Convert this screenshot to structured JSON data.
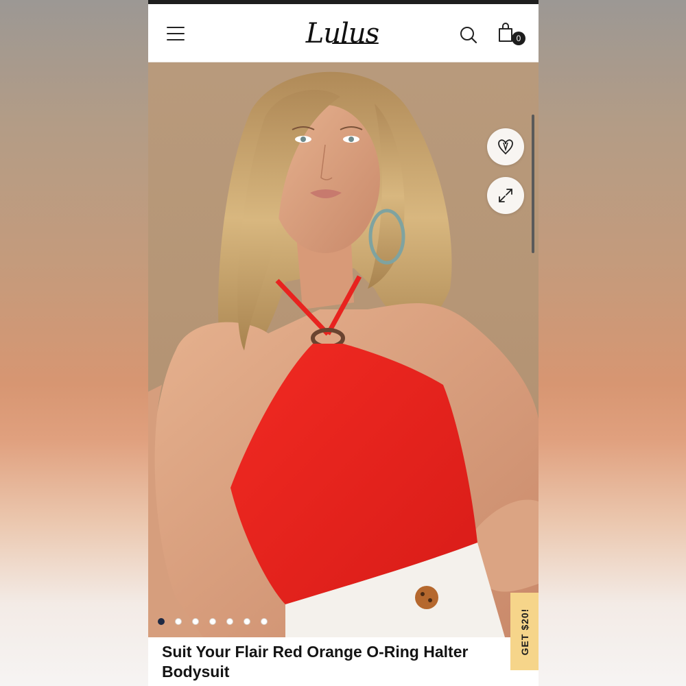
{
  "header": {
    "logo_text": "Lulus",
    "cart_count": "0"
  },
  "icons": {
    "menu": "hamburger-menu-icon",
    "search": "search-icon",
    "cart": "shopping-bag-icon",
    "favorite": "heart-icon",
    "expand": "expand-arrows-icon"
  },
  "gallery": {
    "image_count": 7,
    "active_index": 0
  },
  "promo": {
    "label": "GET $20!",
    "color": "#f6d58a"
  },
  "product": {
    "title": "Suit Your Flair Red Orange O-Ring Halter Bodysuit",
    "color": "#e8231f"
  }
}
